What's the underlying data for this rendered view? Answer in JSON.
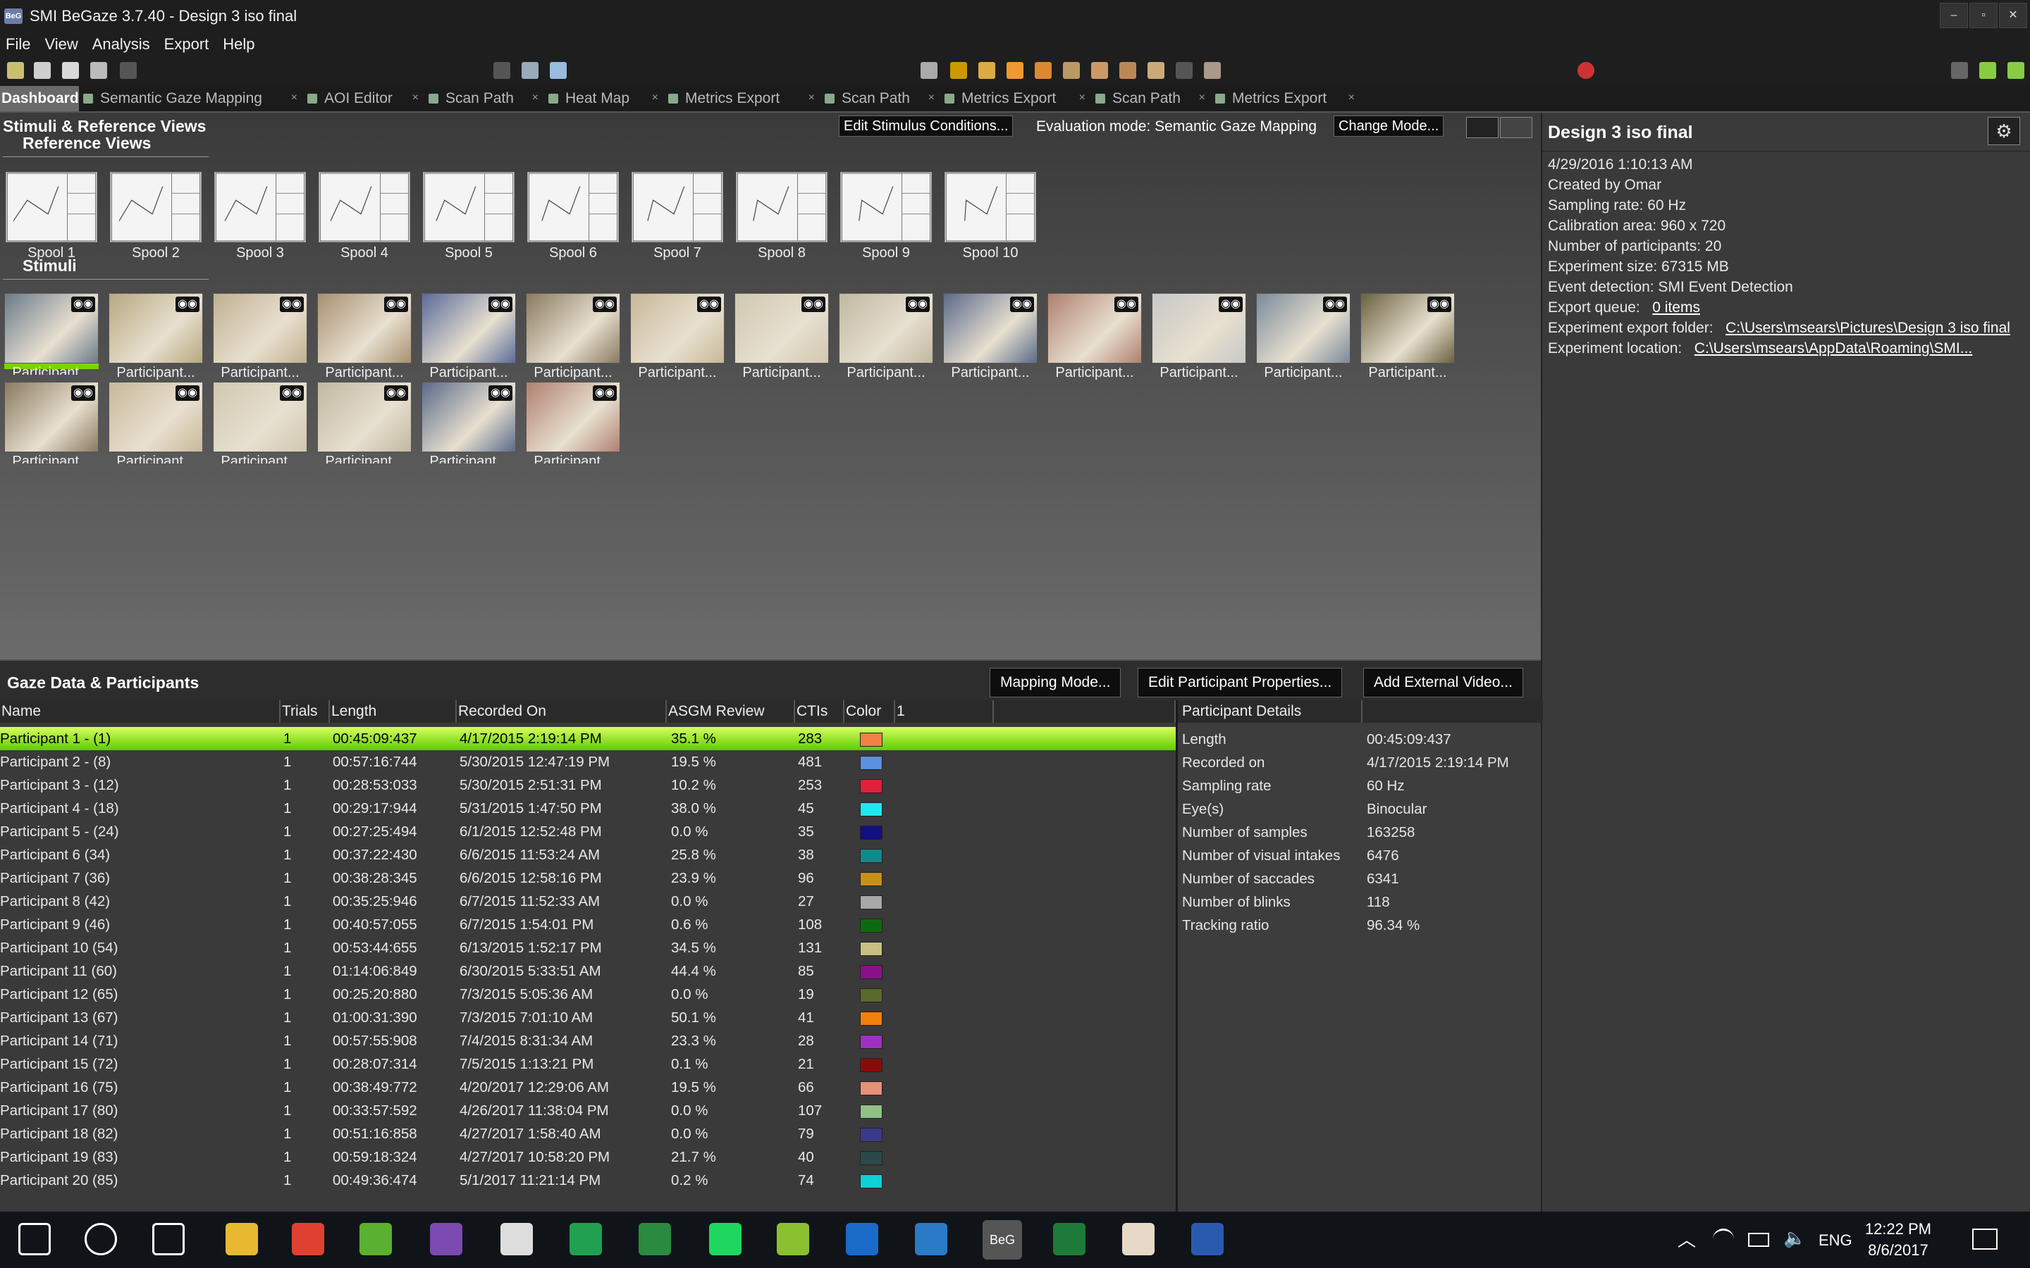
{
  "window": {
    "title": "SMI BeGaze 3.7.40 - Design 3 iso final",
    "logo": "BeG",
    "controls": [
      "–",
      "▫",
      "✕"
    ]
  },
  "menu": [
    "File",
    "View",
    "Analysis",
    "Export",
    "Help"
  ],
  "tabs": [
    {
      "label": "Dashboard",
      "active": true
    },
    {
      "label": "Semantic Gaze Mapping"
    },
    {
      "label": "AOI Editor"
    },
    {
      "label": "Scan Path"
    },
    {
      "label": "Heat Map"
    },
    {
      "label": "Metrics Export"
    },
    {
      "label": "Scan Path"
    },
    {
      "label": "Metrics Export"
    },
    {
      "label": "Scan Path"
    },
    {
      "label": "Metrics Export"
    }
  ],
  "stimuli_panel": {
    "title": "Stimuli & Reference Views",
    "edit_button": "Edit Stimulus Conditions...",
    "eval_mode": "Evaluation mode: Semantic Gaze Mapping",
    "change_mode_button": "Change Mode...",
    "reference_views_label": "Reference Views",
    "reference_views": [
      "Spool 1",
      "Spool 2",
      "Spool 3",
      "Spool 4",
      "Spool 5",
      "Spool 6",
      "Spool 7",
      "Spool 8",
      "Spool 9",
      "Spool 10"
    ],
    "stimuli_label": "Stimuli",
    "stimulus_caption": "Participant..."
  },
  "info": {
    "title": "Design 3 iso final",
    "date": "4/29/2016 1:10:13 AM",
    "created_by": "Created by Omar",
    "sampling_rate": "Sampling rate: 60 Hz",
    "calibration_area": "Calibration area: 960 x 720",
    "num_participants": "Number of participants: 20",
    "experiment_size": "Experiment size: 67315 MB",
    "event_detection": "Event detection: SMI Event Detection",
    "export_queue_label": "Export queue:",
    "export_queue_value": "0 items",
    "export_folder_label": "Experiment export folder:",
    "export_folder_value": "C:\\Users\\msears\\Pictures\\Design 3 iso final",
    "location_label": "Experiment location:",
    "location_value": "C:\\Users\\msears\\AppData\\Roaming\\SMI..."
  },
  "gaze": {
    "title": "Gaze Data & Participants",
    "buttons": {
      "mapping": "Mapping Mode...",
      "edit_props": "Edit Participant Properties...",
      "add_video": "Add External Video..."
    },
    "columns": [
      "Name",
      "Trials",
      "Length",
      "Recorded On",
      "ASGM Review",
      "CTIs",
      "Color",
      "1"
    ],
    "rows": [
      {
        "name": "Participant 1 - (1)",
        "trials": "1",
        "length": "00:45:09:437",
        "recorded": "4/17/2015 2:19:14 PM",
        "review": "35.1 %",
        "ctis": "283",
        "color": "#f08048"
      },
      {
        "name": "Participant 2 - (8)",
        "trials": "1",
        "length": "00:57:16:744",
        "recorded": "5/30/2015 12:47:19 PM",
        "review": "19.5 %",
        "ctis": "481",
        "color": "#5b8fe0"
      },
      {
        "name": "Participant 3 - (12)",
        "trials": "1",
        "length": "00:28:53:033",
        "recorded": "5/30/2015 2:51:31 PM",
        "review": "10.2 %",
        "ctis": "253",
        "color": "#e0203a"
      },
      {
        "name": "Participant 4 - (18)",
        "trials": "1",
        "length": "00:29:17:944",
        "recorded": "5/31/2015 1:47:50 PM",
        "review": "38.0 %",
        "ctis": "45",
        "color": "#1ee8f0"
      },
      {
        "name": "Participant 5 - (24)",
        "trials": "1",
        "length": "00:27:25:494",
        "recorded": "6/1/2015 12:52:48 PM",
        "review": "0.0 %",
        "ctis": "35",
        "color": "#101080"
      },
      {
        "name": "Participant 6 (34)",
        "trials": "1",
        "length": "00:37:22:430",
        "recorded": "6/6/2015 11:53:24 AM",
        "review": "25.8 %",
        "ctis": "38",
        "color": "#108a8a"
      },
      {
        "name": "Participant 7 (36)",
        "trials": "1",
        "length": "00:38:28:345",
        "recorded": "6/6/2015 12:58:16 PM",
        "review": "23.9 %",
        "ctis": "96",
        "color": "#c89018"
      },
      {
        "name": "Participant 8 (42)",
        "trials": "1",
        "length": "00:35:25:946",
        "recorded": "6/7/2015 11:52:33 AM",
        "review": "0.0 %",
        "ctis": "27",
        "color": "#a8a8a8"
      },
      {
        "name": "Participant 9 (46)",
        "trials": "1",
        "length": "00:40:57:055",
        "recorded": "6/7/2015 1:54:01 PM",
        "review": "0.6 %",
        "ctis": "108",
        "color": "#0e6a10"
      },
      {
        "name": "Participant 10 (54)",
        "trials": "1",
        "length": "00:53:44:655",
        "recorded": "6/13/2015 1:52:17 PM",
        "review": "34.5 %",
        "ctis": "131",
        "color": "#c8c080"
      },
      {
        "name": "Participant 11 (60)",
        "trials": "1",
        "length": "01:14:06:849",
        "recorded": "6/30/2015 5:33:51 AM",
        "review": "44.4 %",
        "ctis": "85",
        "color": "#8a108a"
      },
      {
        "name": "Participant 12 (65)",
        "trials": "1",
        "length": "00:25:20:880",
        "recorded": "7/3/2015 5:05:36 AM",
        "review": "0.0 %",
        "ctis": "19",
        "color": "#5a6a2a"
      },
      {
        "name": "Participant 13 (67)",
        "trials": "1",
        "length": "01:00:31:390",
        "recorded": "7/3/2015 7:01:10 AM",
        "review": "50.1 %",
        "ctis": "41",
        "color": "#f08010"
      },
      {
        "name": "Participant 14 (71)",
        "trials": "1",
        "length": "00:57:55:908",
        "recorded": "7/4/2015 8:31:34 AM",
        "review": "23.3 %",
        "ctis": "28",
        "color": "#a030c0"
      },
      {
        "name": "Participant 15 (72)",
        "trials": "1",
        "length": "00:28:07:314",
        "recorded": "7/5/2015 1:13:21 PM",
        "review": "0.1 %",
        "ctis": "21",
        "color": "#8a0a0a"
      },
      {
        "name": "Participant 16 (75)",
        "trials": "1",
        "length": "00:38:49:772",
        "recorded": "4/20/2017 12:29:06 AM",
        "review": "19.5 %",
        "ctis": "66",
        "color": "#e89078"
      },
      {
        "name": "Participant 17 (80)",
        "trials": "1",
        "length": "00:33:57:592",
        "recorded": "4/26/2017 11:38:04 PM",
        "review": "0.0 %",
        "ctis": "107",
        "color": "#90c088"
      },
      {
        "name": "Participant 18 (82)",
        "trials": "1",
        "length": "00:51:16:858",
        "recorded": "4/27/2017 1:58:40 AM",
        "review": "0.0 %",
        "ctis": "79",
        "color": "#3a3a8a"
      },
      {
        "name": "Participant 19 (83)",
        "trials": "1",
        "length": "00:59:18:324",
        "recorded": "4/27/2017 10:58:20 PM",
        "review": "21.7 %",
        "ctis": "40",
        "color": "#2a4a4a"
      },
      {
        "name": "Participant 20 (85)",
        "trials": "1",
        "length": "00:49:36:474",
        "recorded": "5/1/2017 11:21:14 PM",
        "review": "0.2 %",
        "ctis": "74",
        "color": "#10d0d8"
      }
    ]
  },
  "details": {
    "header": "Participant Details",
    "items": [
      {
        "label": "Length",
        "value": "00:45:09:437"
      },
      {
        "label": "Recorded on",
        "value": "4/17/2015 2:19:14 PM"
      },
      {
        "label": "Sampling rate",
        "value": "60 Hz"
      },
      {
        "label": "Eye(s)",
        "value": "Binocular"
      },
      {
        "label": "Number of  samples",
        "value": "163258"
      },
      {
        "label": "Number of  visual intakes",
        "value": "6476"
      },
      {
        "label": "Number of  saccades",
        "value": "6341"
      },
      {
        "label": "Number of  blinks",
        "value": "118"
      },
      {
        "label": "Tracking ratio",
        "value": "96.34 %"
      }
    ]
  },
  "taskbar": {
    "time": "12:22 PM",
    "date": "8/6/2017",
    "lang": "ENG",
    "apps": [
      "start-icon",
      "cortana-icon",
      "task-view-icon",
      "file-explorer-icon",
      "chrome-icon",
      "app-green-icon",
      "visual-studio-icon",
      "unity-icon",
      "hangouts-icon",
      "project-icon",
      "spotify-icon",
      "vectorworks-icon",
      "outlook-icon",
      "autocad-icon",
      "begaze-icon",
      "excel-icon",
      "java-icon",
      "word-icon"
    ],
    "begaze_label": "BeG"
  }
}
